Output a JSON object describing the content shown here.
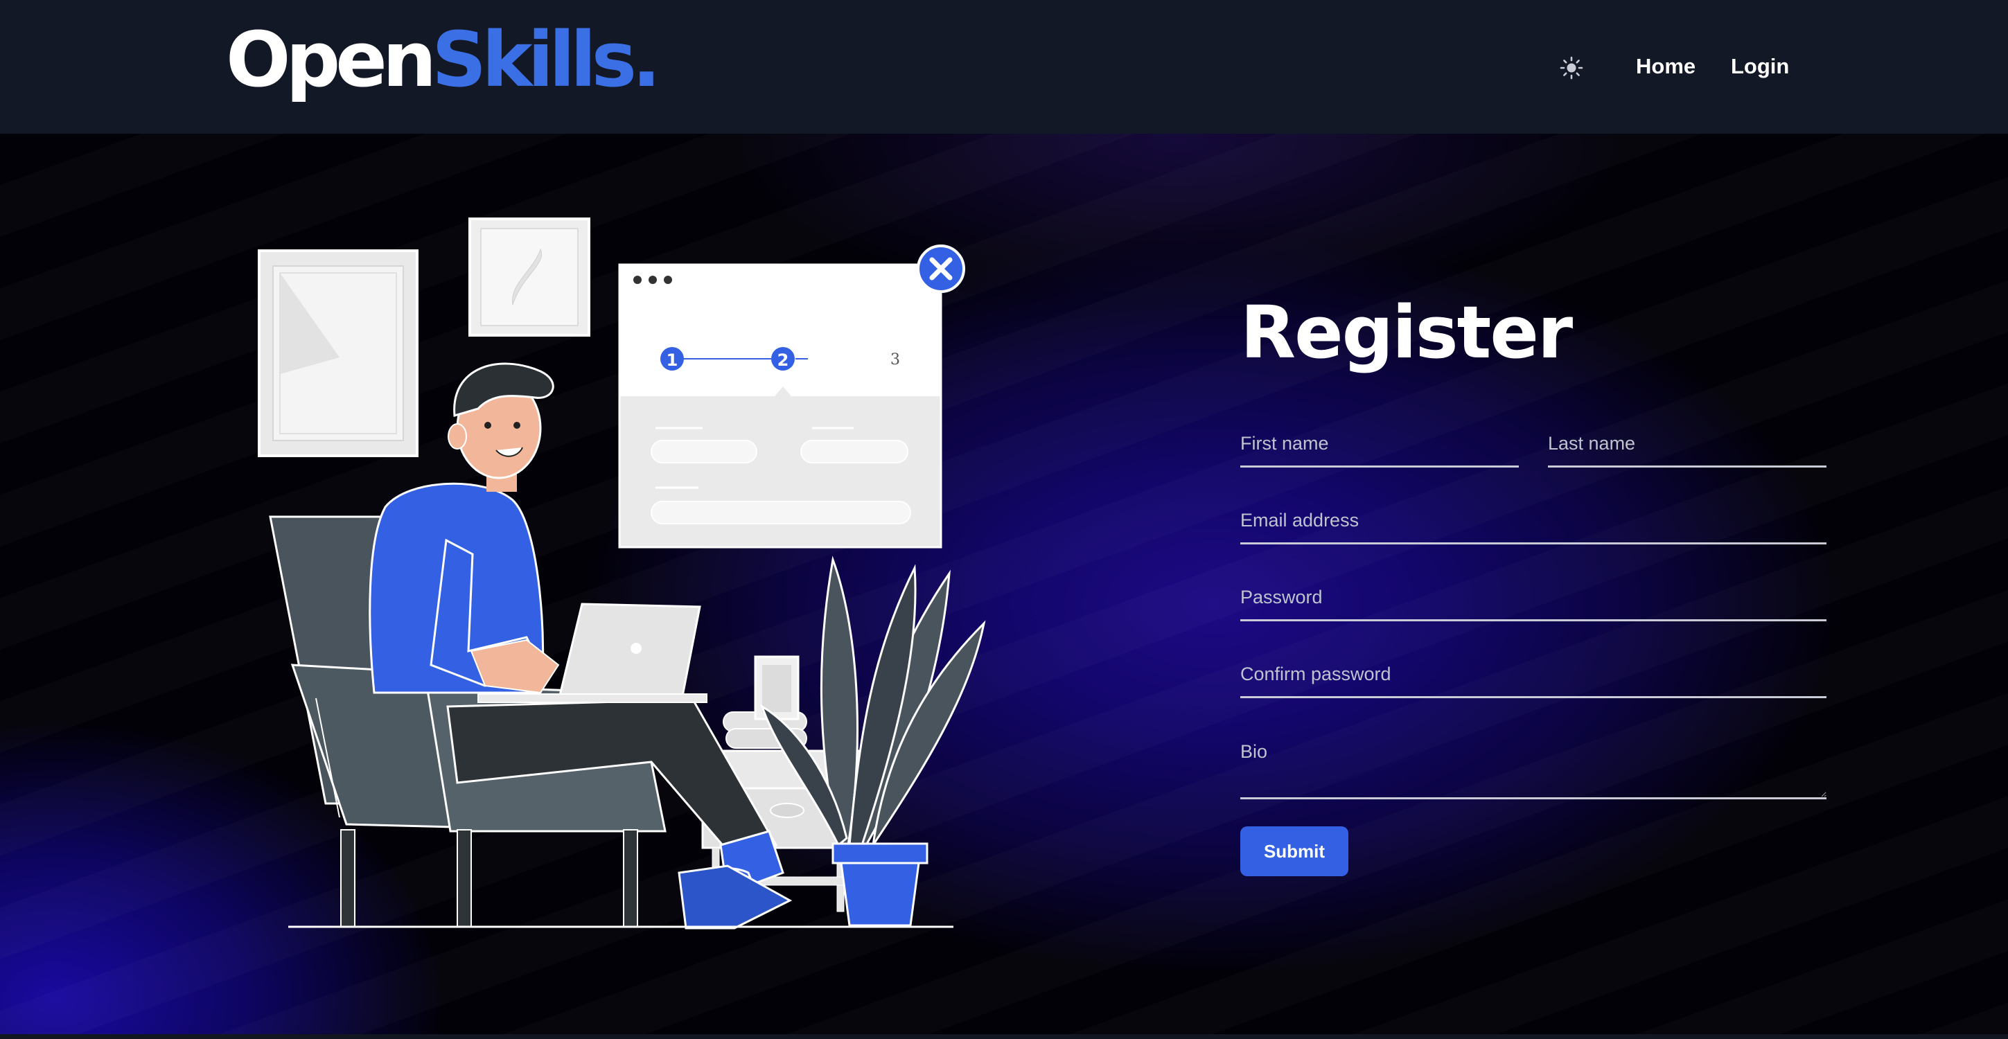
{
  "brand": {
    "part1": "Open",
    "part2": "Skills",
    "dot": "."
  },
  "nav": {
    "theme_icon": "sun-icon",
    "home_label": "Home",
    "login_label": "Login"
  },
  "illustration": {
    "steps": [
      "1",
      "2",
      "3"
    ],
    "current_step": 2,
    "close_icon": "close-icon"
  },
  "form": {
    "title": "Register",
    "first_name_placeholder": "First name",
    "last_name_placeholder": "Last name",
    "email_placeholder": "Email address",
    "password_placeholder": "Password",
    "confirm_password_placeholder": "Confirm password",
    "bio_placeholder": "Bio",
    "submit_label": "Submit"
  },
  "colors": {
    "navbar_bg": "#121826",
    "accent": "#3461e3",
    "brand_blue": "#3b6fe5",
    "hero_glow": "#1d0a85"
  }
}
